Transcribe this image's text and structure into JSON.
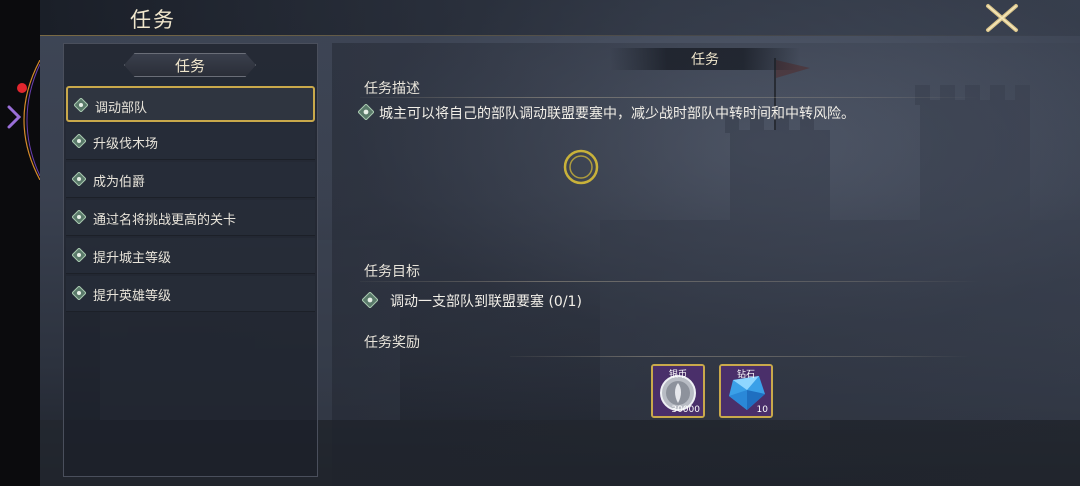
{
  "header": {
    "title": "任务"
  },
  "left_panel": {
    "title": "任务",
    "quests": [
      {
        "label": "调动部队",
        "selected": true
      },
      {
        "label": "升级伐木场",
        "selected": false
      },
      {
        "label": "成为伯爵",
        "selected": false
      },
      {
        "label": "通过名将挑战更高的关卡",
        "selected": false
      },
      {
        "label": "提升城主等级",
        "selected": false
      },
      {
        "label": "提升英雄等级",
        "selected": false
      }
    ]
  },
  "detail": {
    "title": "任务",
    "description_heading": "任务描述",
    "description": "城主可以将自己的部队调动联盟要塞中，减少战时部队中转时间和中转风险。",
    "goal_heading": "任务目标",
    "goal": "调动一支部队到联盟要塞 (0/1)",
    "reward_heading": "任务奖励",
    "rewards": [
      {
        "name": "银币",
        "count": "30000",
        "icon": "silver-coin-icon"
      },
      {
        "name": "钻石",
        "count": "10",
        "icon": "diamond-icon"
      }
    ]
  },
  "colors": {
    "accent_gold": "#c9a94b",
    "text": "#e8e4da",
    "notification_red": "#e2262e"
  }
}
